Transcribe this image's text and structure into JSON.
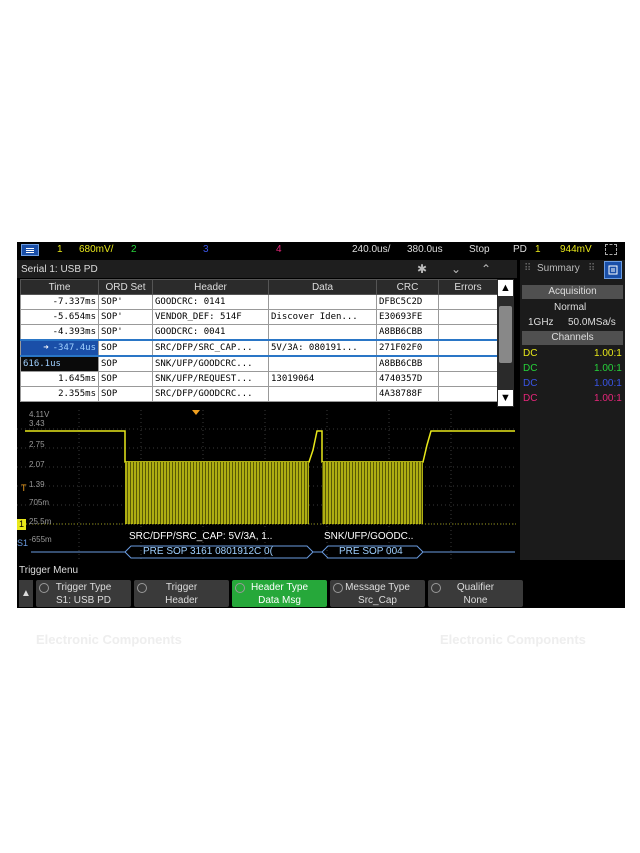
{
  "status_bar": {
    "ch1_num": "1",
    "ch1_scale": "680mV/",
    "ch2_num": "2",
    "ch3_num": "3",
    "ch4_num": "4",
    "timebase": "240.0us/",
    "delay": "380.0us",
    "run_state": "Stop",
    "trig_source": "PD",
    "trig_ch": "1",
    "trig_level": "944mV"
  },
  "serial": {
    "title": "Serial 1: USB PD"
  },
  "table": {
    "headers": [
      "Time",
      "ORD Set",
      "Header",
      "Data",
      "CRC",
      "Errors"
    ],
    "rows": [
      {
        "time": "-7.337ms",
        "ord": "SOP'",
        "header": "GOODCRC: 0141",
        "data": "",
        "crc": "DFBC5C2D",
        "errors": ""
      },
      {
        "time": "-5.654ms",
        "ord": "SOP'",
        "header": "VENDOR_DEF: 514F",
        "data": "Discover Iden...",
        "crc": "E30693FE",
        "errors": ""
      },
      {
        "time": "-4.393ms",
        "ord": "SOP'",
        "header": "GOODCRC: 0041",
        "data": "",
        "crc": "A8BB6CBB",
        "errors": ""
      },
      {
        "time": "-347.4us",
        "ord": "SOP",
        "header": "SRC/DFP/SRC_CAP...",
        "data": "5V/3A: 080191...",
        "crc": "271F02F0",
        "errors": ""
      },
      {
        "time": "616.1us",
        "ord": "SOP",
        "header": "SNK/UFP/GOODCRC...",
        "data": "",
        "crc": "A8BB6CBB",
        "errors": ""
      },
      {
        "time": "1.645ms",
        "ord": "SOP",
        "header": "SNK/UFP/REQUEST...",
        "data": "13019064",
        "crc": "4740357D",
        "errors": ""
      },
      {
        "time": "2.355ms",
        "ord": "SOP",
        "header": "SRC/DFP/GOODCRC...",
        "data": "",
        "crc": "4A38788F",
        "errors": ""
      }
    ],
    "selected_arrow": "➜"
  },
  "waveform": {
    "levels": [
      "4.11V",
      "3.43",
      "2.75",
      "2.07",
      "1.39",
      "705m",
      "25.5m",
      "-655m"
    ],
    "decode1": "SRC/DFP/SRC_CAP: 5V/3A, 1..",
    "decode2": "SNK/UFP/GOODC..",
    "bus1": "PRE SOP 3161 0801912C 0(",
    "bus2": "PRE SOP 004",
    "trace_color": "#e8e81a",
    "t_marker": "T",
    "ch1_marker": "1",
    "s1_marker": "S1"
  },
  "right_panel": {
    "tab_label": "Summary",
    "acq_header": "Acquisition",
    "acq_mode": "Normal",
    "bandwidth": "1GHz",
    "sample_rate": "50.0MSa/s",
    "ch_header": "Channels",
    "channels": [
      {
        "coupling": "DC",
        "probe": "1.00:1",
        "color": "#e8e81a"
      },
      {
        "coupling": "DC",
        "probe": "1.00:1",
        "color": "#26d13a"
      },
      {
        "coupling": "DC",
        "probe": "1.00:1",
        "color": "#3a55e6"
      },
      {
        "coupling": "DC",
        "probe": "1.00:1",
        "color": "#e6267a"
      }
    ]
  },
  "trigger_menu": {
    "label": "Trigger Menu",
    "softkeys": [
      {
        "l1": "Trigger Type",
        "l2": "S1: USB PD"
      },
      {
        "l1": "Trigger",
        "l2": "Header"
      },
      {
        "l1": "Header Type",
        "l2": "Data Msg"
      },
      {
        "l1": "Message Type",
        "l2": "Src_Cap"
      },
      {
        "l1": "Qualifier",
        "l2": "None"
      }
    ]
  },
  "watermark": {
    "text": "Electronic Components",
    "logo_letters": "M"
  }
}
